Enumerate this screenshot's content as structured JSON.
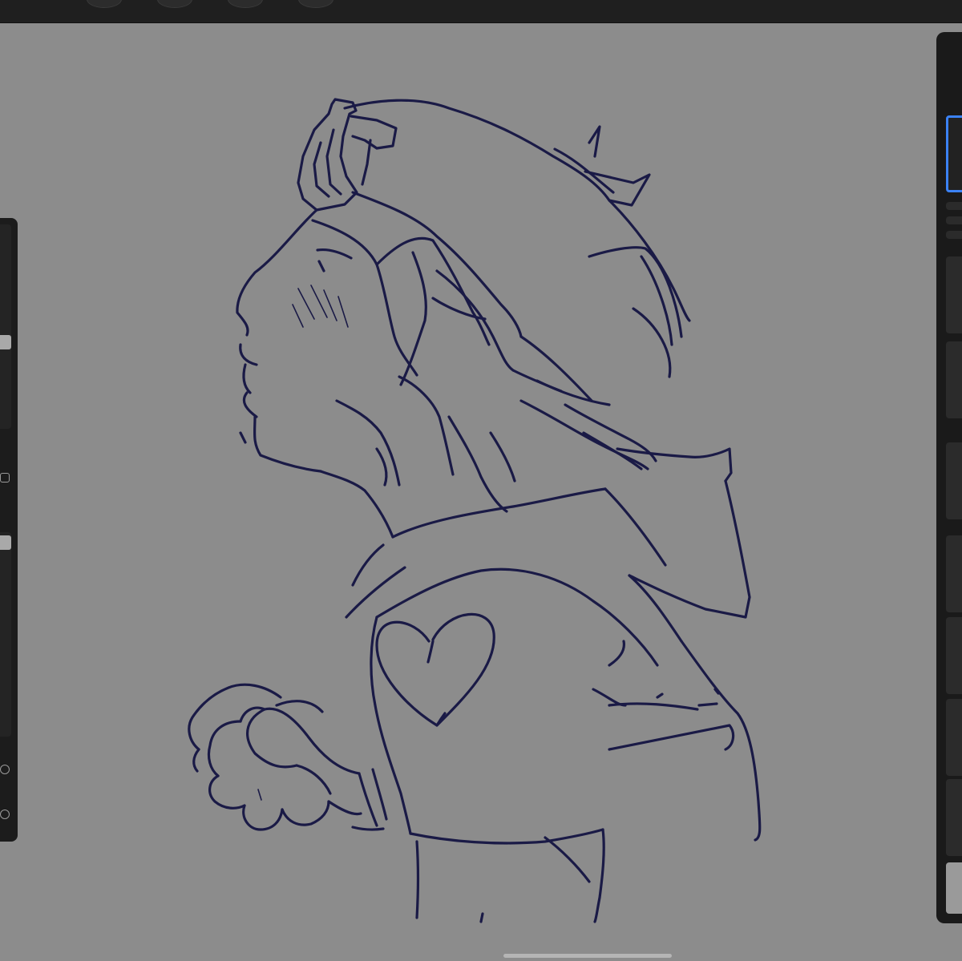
{
  "app": {
    "type": "drawing-canvas",
    "canvas_color": "#8c8c8c",
    "stroke_color": "#1a1a46"
  },
  "toolbar": {
    "icons": [
      "brush-icon",
      "smudge-icon",
      "eraser-icon",
      "layers-icon"
    ]
  },
  "left_sidebar": {
    "controls": [
      "brush-size-slider",
      "modify-button",
      "brush-opacity-slider",
      "undo-button",
      "redo-button"
    ]
  },
  "layers_panel": {
    "rows": [
      {
        "name": "layer-1",
        "active": true
      },
      {
        "name": "layer-2",
        "active": false
      },
      {
        "name": "layer-3",
        "active": false
      },
      {
        "name": "layer-4",
        "active": false
      },
      {
        "name": "layer-5",
        "active": false
      },
      {
        "name": "layer-6",
        "active": false
      },
      {
        "name": "layer-7",
        "active": false
      },
      {
        "name": "layer-8",
        "active": false
      },
      {
        "name": "background-color",
        "active": false
      }
    ]
  }
}
